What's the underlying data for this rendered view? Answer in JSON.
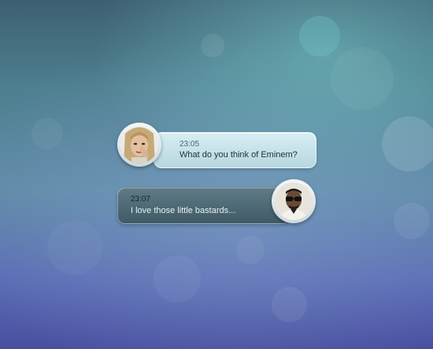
{
  "chat": {
    "messages": [
      {
        "time": "23:05",
        "text": "What do you think of Eminem?",
        "direction": "incoming",
        "avatar_icon": "woman-portrait-icon"
      },
      {
        "time": "23:07",
        "text": "I love those little bastards...",
        "direction": "outgoing",
        "avatar_icon": "man-portrait-icon"
      }
    ]
  },
  "colors": {
    "bubble_incoming": "#c8e3ea",
    "bubble_outgoing": "#4d6874",
    "background_top": "#3e5f72",
    "background_bottom": "#4a4fa0"
  }
}
